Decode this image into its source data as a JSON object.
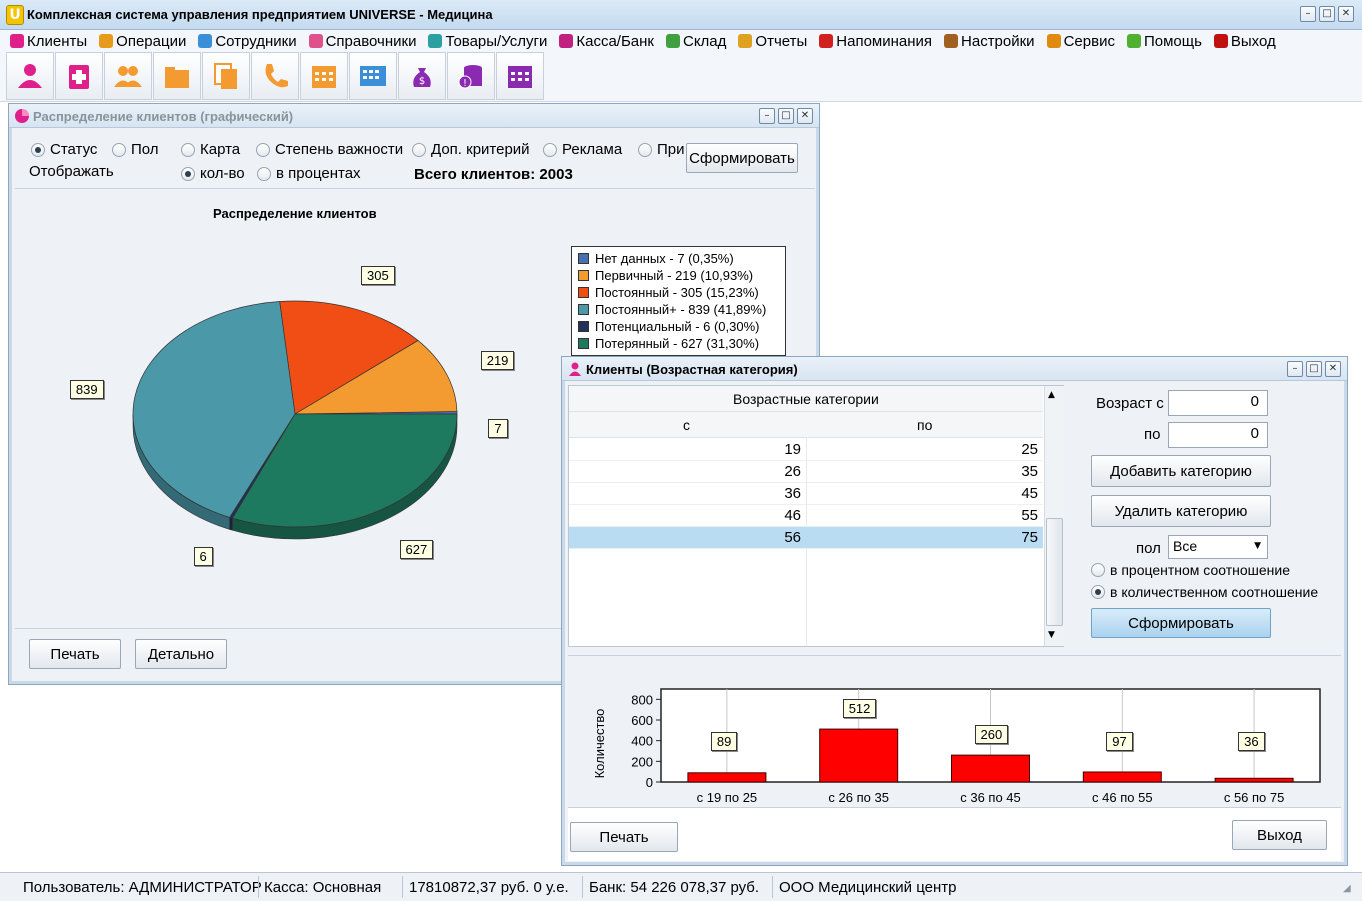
{
  "window": {
    "title": "Комплексная система управления предприятием UNIVERSE - Медицина",
    "logo": "U"
  },
  "menu": [
    {
      "label": "Клиенты",
      "icon": "user-icon",
      "color": "#e0208a"
    },
    {
      "label": "Операции",
      "icon": "operations-icon",
      "color": "#e89a1a"
    },
    {
      "label": "Сотрудники",
      "icon": "staff-icon",
      "color": "#3a8fd8"
    },
    {
      "label": "Справочники",
      "icon": "book-icon",
      "color": "#e0508a"
    },
    {
      "label": "Товары/Услуги",
      "icon": "goods-icon",
      "color": "#2aa0a0"
    },
    {
      "label": "Касса/Банк",
      "icon": "cash-icon",
      "color": "#c02080"
    },
    {
      "label": "Склад",
      "icon": "warehouse-icon",
      "color": "#40a040"
    },
    {
      "label": "Отчеты",
      "icon": "report-icon",
      "color": "#e0a020"
    },
    {
      "label": "Напоминания",
      "icon": "clock-icon",
      "color": "#d02020"
    },
    {
      "label": "Настройки",
      "icon": "gear-icon",
      "color": "#a06020"
    },
    {
      "label": "Сервис",
      "icon": "service-icon",
      "color": "#e08a10"
    },
    {
      "label": "Помощь",
      "icon": "help-icon",
      "color": "#50b030"
    },
    {
      "label": "Выход",
      "icon": "exit-icon",
      "color": "#c01010"
    }
  ],
  "toolbar": [
    "clients-icon",
    "medical-card-icon",
    "group-icon",
    "folder-icon",
    "documents-icon",
    "phone-icon",
    "calendar-icon",
    "schedule-icon",
    "money-bag-icon",
    "coins-icon",
    "calendar-purple-icon"
  ],
  "dist": {
    "title": "Распределение клиентов (графический)",
    "radios": [
      "Статус",
      "Пол",
      "Карта",
      "Степень важности",
      "Доп. критерий",
      "Реклама",
      "При"
    ],
    "display_label": "Отображать",
    "display": [
      "кол-во",
      "в процентах"
    ],
    "total": "Всего клиентов: 2003",
    "form_btn": "Сформировать",
    "print_btn": "Печать",
    "detail_btn": "Детально",
    "chart_data": {
      "type": "pie",
      "title": "Распределение клиентов",
      "legend_position": "right",
      "slices": [
        {
          "label": "Нет данных - 7 (0,35%)",
          "value": 7,
          "color": "#4a6fb0"
        },
        {
          "label": "Первичный - 219 (10,93%)",
          "value": 219,
          "color": "#f39a30"
        },
        {
          "label": "Постоянный - 305 (15,23%)",
          "value": 305,
          "color": "#f04e14"
        },
        {
          "label": "Постоянный+ - 839 (41,89%)",
          "value": 839,
          "color": "#4a98a8"
        },
        {
          "label": "Потенциальный - 6 (0,30%)",
          "value": 6,
          "color": "#23305a"
        },
        {
          "label": "Потерянный - 627 (31,30%)",
          "value": 627,
          "color": "#1e7a5e"
        }
      ],
      "value_labels": [
        "7",
        "219",
        "305",
        "839",
        "6",
        "627"
      ]
    }
  },
  "age": {
    "title": "Клиенты (Возрастная категория)",
    "table_header": "Возрастные категории",
    "col_from": "с",
    "col_to": "по",
    "rows": [
      [
        "19",
        "25"
      ],
      [
        "26",
        "35"
      ],
      [
        "36",
        "45"
      ],
      [
        "46",
        "55"
      ],
      [
        "56",
        "75"
      ]
    ],
    "age_from_label": "Возраст с",
    "age_to_label": "по",
    "age_from_value": "0",
    "age_to_value": "0",
    "add_btn": "Добавить категорию",
    "del_btn": "Удалить категорию",
    "sex_label": "пол",
    "sex_value": "Все",
    "opt_percent": "в процентном соотношение",
    "opt_count": "в количественном соотношение",
    "form_btn": "Сформировать",
    "print_btn": "Печать",
    "exit_btn": "Выход",
    "chart_data": {
      "type": "bar",
      "categories": [
        "с 19 по 25",
        "с 26 по 35",
        "с 36 по 45",
        "с 46 по 55",
        "с 56 по 75"
      ],
      "values": [
        89,
        512,
        260,
        97,
        36
      ],
      "ylabel": "Количество",
      "ylim": [
        0,
        900
      ],
      "yticks": [
        "800",
        "600",
        "400",
        "200",
        "0"
      ],
      "grid": true,
      "color": "#ff0000"
    }
  },
  "status": {
    "user": "Пользователь: АДМИНИСТРАТОР",
    "cash": "Касса: Основная",
    "sum": "17810872,37 руб. 0 у.е.",
    "bank": "Банк: 54 226 078,37 руб.",
    "org": "ООО Медицинский центр"
  }
}
